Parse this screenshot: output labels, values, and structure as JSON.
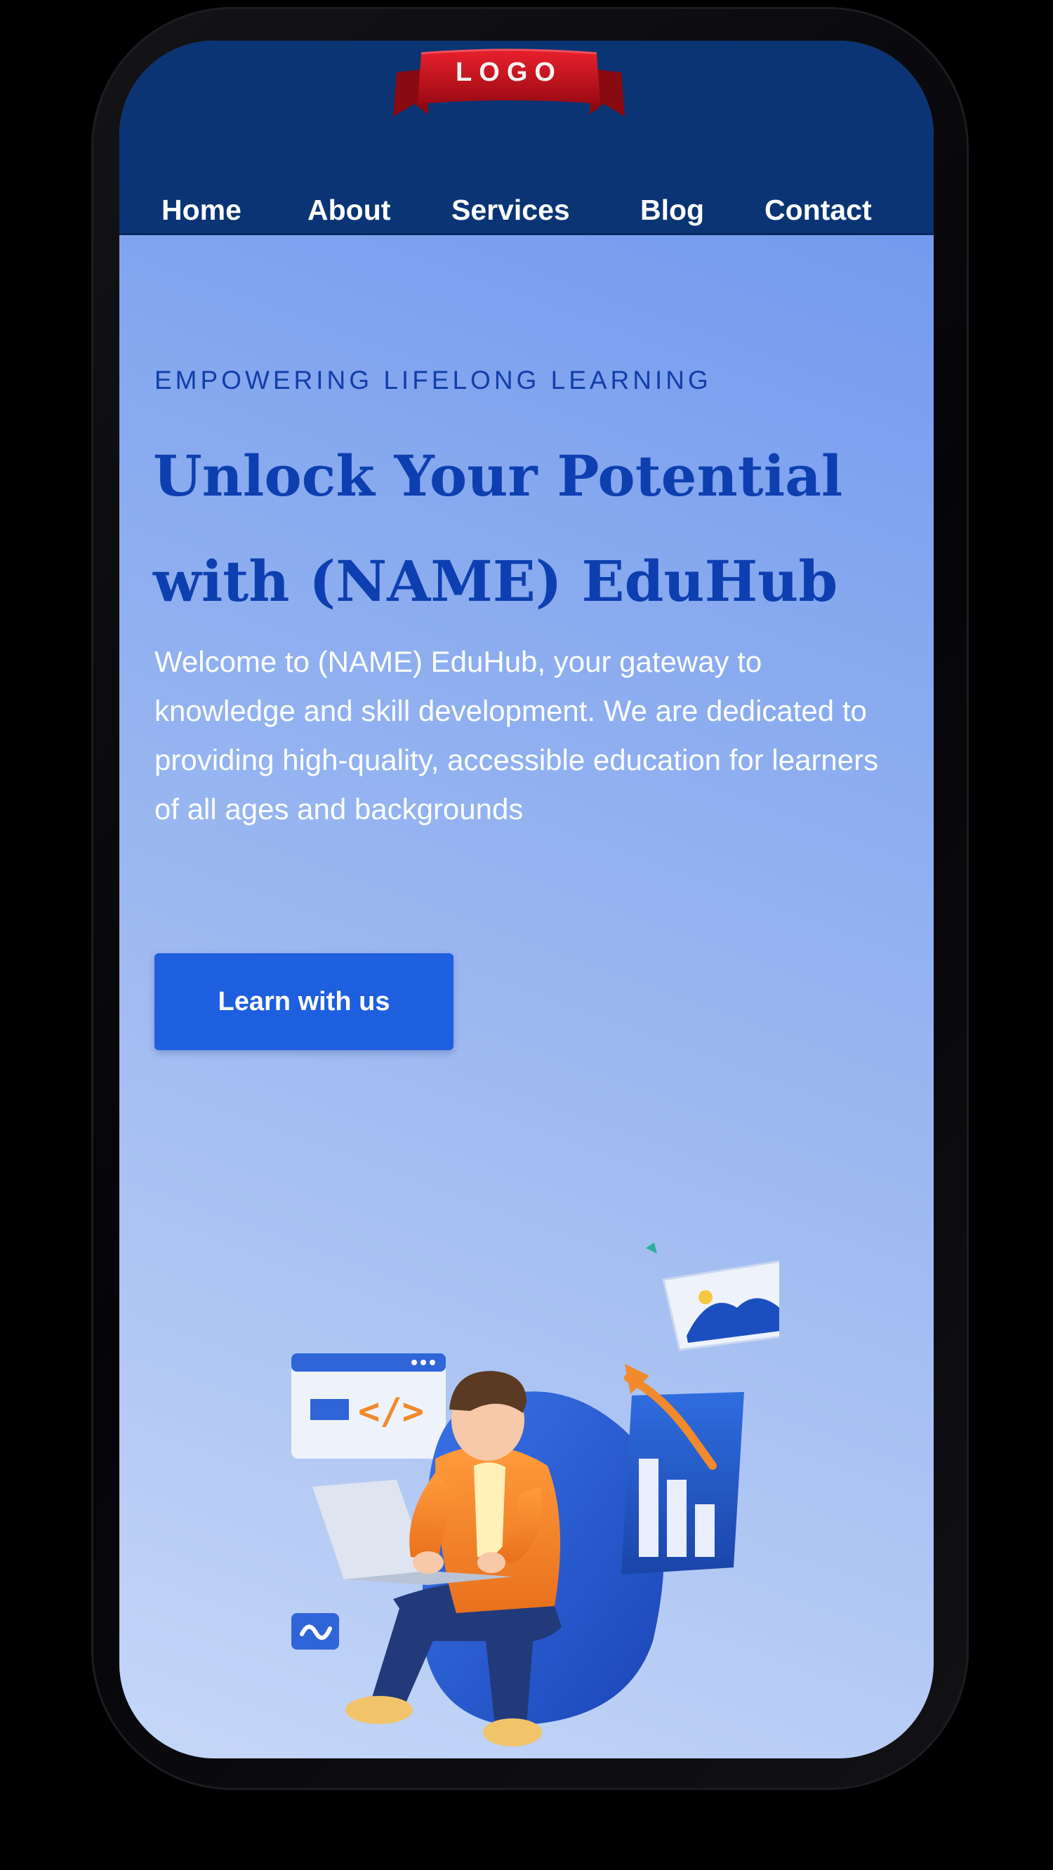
{
  "logo": {
    "text": "LOGO"
  },
  "nav": {
    "items": [
      {
        "label": "Home"
      },
      {
        "label": "About"
      },
      {
        "label": "Services"
      },
      {
        "label": "Blog"
      },
      {
        "label": "Contact"
      }
    ]
  },
  "hero": {
    "eyebrow": "EMPOWERING LIFELONG LEARNING",
    "title": "Unlock Your Potential with (NAME) EduHub",
    "description": "Welcome to (NAME) EduHub, your gateway to knowledge and skill development. We are dedicated to providing high-quality, accessible education for learners of all ages and backgrounds",
    "cta_label": "Learn with us"
  },
  "colors": {
    "header_bg": "#0a3474",
    "accent": "#1d5fde",
    "title": "#0e3fb0",
    "ribbon": "#c8101c"
  },
  "icons": {
    "illustration": "person-learning-on-laptop-illustration",
    "code_window": "code-window-icon",
    "chart": "bar-chart-icon",
    "image_card": "image-card-icon"
  }
}
